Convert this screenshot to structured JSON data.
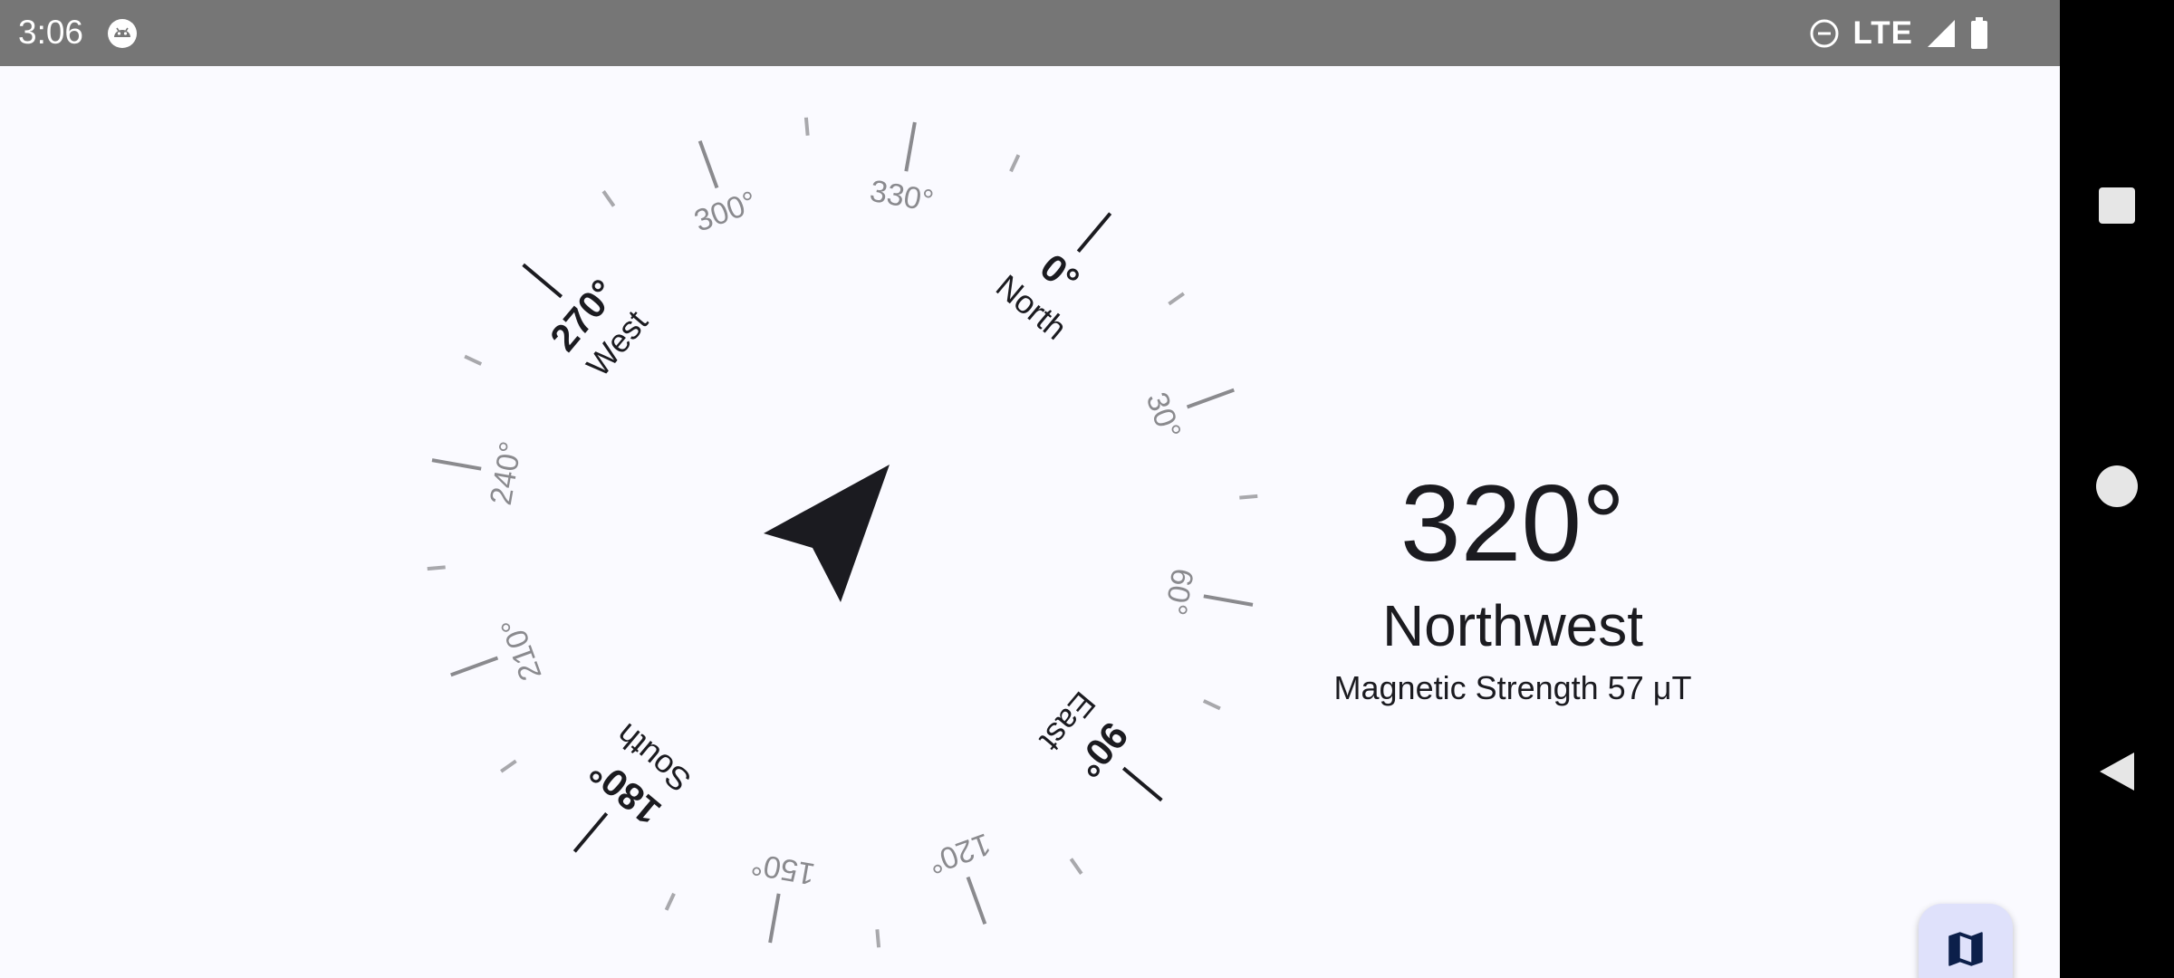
{
  "status_bar": {
    "time": "3:06",
    "network": "LTE",
    "icons": [
      "android-app-icon",
      "do-not-disturb-icon",
      "signal-icon",
      "battery-icon"
    ]
  },
  "compass": {
    "heading_degrees": 320,
    "cardinals": [
      {
        "deg": 0,
        "degree_label": "0°",
        "direction_label": "North"
      },
      {
        "deg": 90,
        "degree_label": "90°",
        "direction_label": "East"
      },
      {
        "deg": 180,
        "degree_label": "180°",
        "direction_label": "South"
      },
      {
        "deg": 270,
        "degree_label": "270°",
        "direction_label": "West"
      }
    ],
    "intermediate_labels": [
      {
        "deg": 30,
        "label": "30°"
      },
      {
        "deg": 60,
        "label": "60°"
      },
      {
        "deg": 120,
        "label": "120°"
      },
      {
        "deg": 150,
        "label": "150°"
      },
      {
        "deg": 210,
        "label": "210°"
      },
      {
        "deg": 240,
        "label": "240°"
      },
      {
        "deg": 300,
        "label": "300°"
      },
      {
        "deg": 330,
        "label": "330°"
      }
    ],
    "colors": {
      "major": "#1b1b20",
      "minor": "#8a8a8e",
      "arrow": "#1b1b20"
    }
  },
  "readout": {
    "heading": "320°",
    "direction": "Northwest",
    "magnetic_strength": "Magnetic Strength 57 μT"
  },
  "fab": {
    "icon": "map-icon",
    "color": "#0c1f4a",
    "background": "#dfe1fb"
  },
  "nav_bar": {
    "icons": [
      "recents-square-icon",
      "home-circle-icon",
      "back-triangle-icon"
    ]
  }
}
